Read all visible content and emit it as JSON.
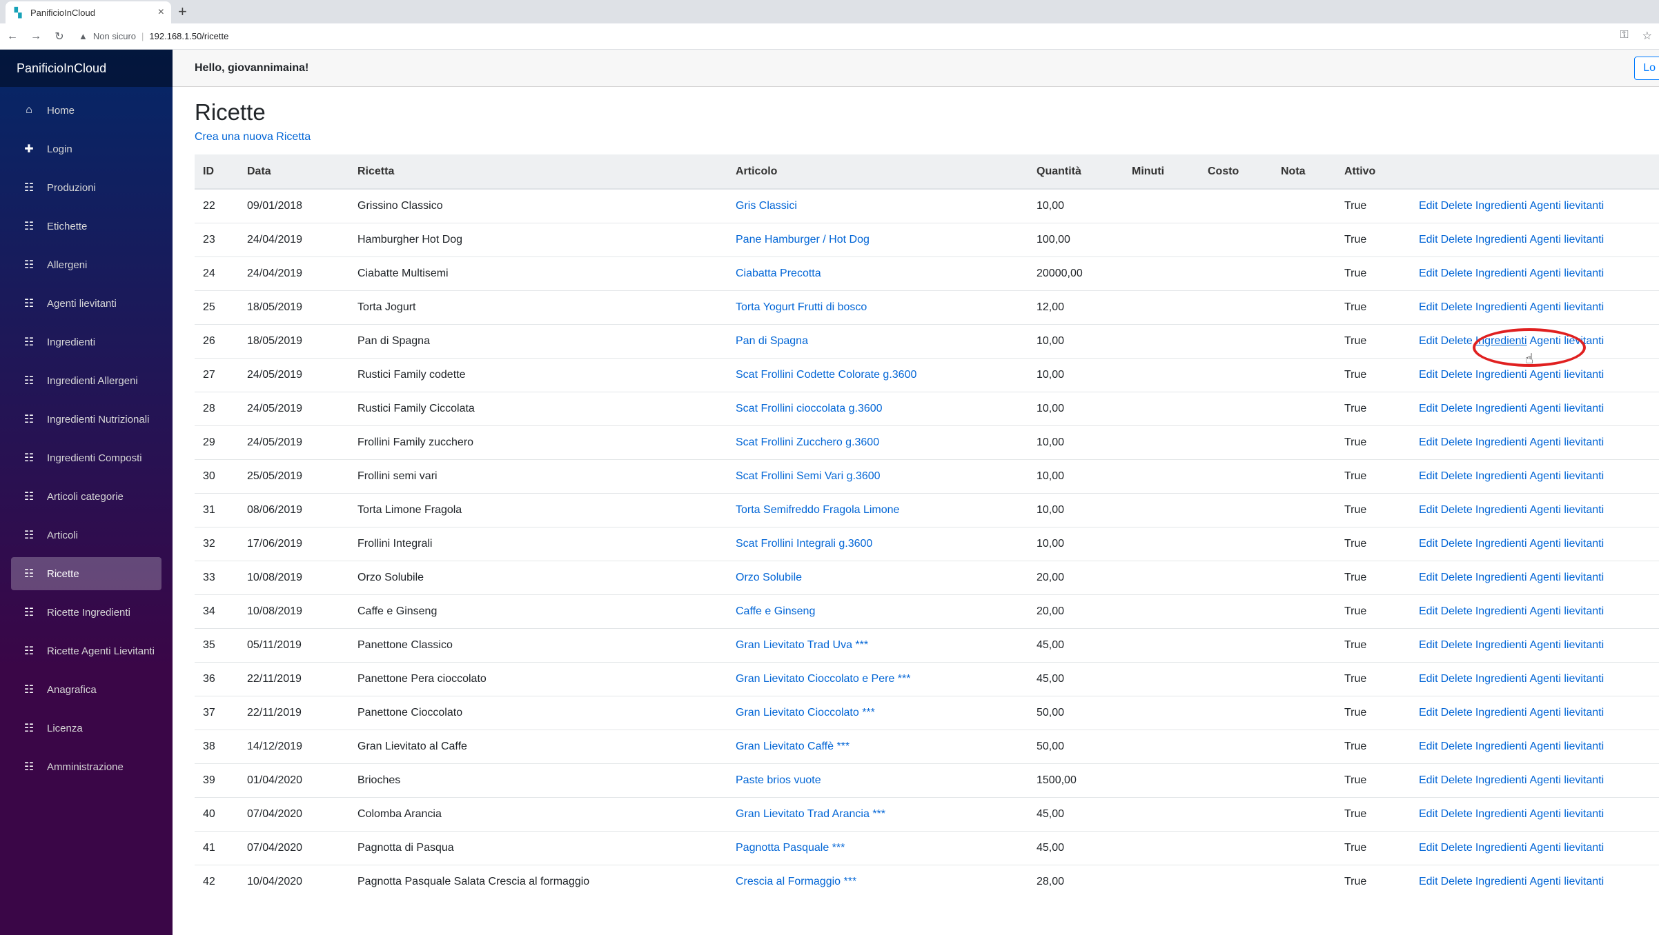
{
  "browser": {
    "tab_title": "PanificioInCloud",
    "new_tab": "+",
    "not_secure": "Non sicuro",
    "url": "192.168.1.50/ricette"
  },
  "sidebar": {
    "brand": "PanificioInCloud",
    "items": [
      {
        "label": "Home",
        "icon": "home-icon"
      },
      {
        "label": "Login",
        "icon": "plus-icon"
      },
      {
        "label": "Produzioni",
        "icon": "list-icon"
      },
      {
        "label": "Etichette",
        "icon": "list-icon"
      },
      {
        "label": "Allergeni",
        "icon": "list-icon"
      },
      {
        "label": "Agenti lievitanti",
        "icon": "list-icon"
      },
      {
        "label": "Ingredienti",
        "icon": "list-icon"
      },
      {
        "label": "Ingredienti Allergeni",
        "icon": "list-icon"
      },
      {
        "label": "Ingredienti Nutrizionali",
        "icon": "list-icon"
      },
      {
        "label": "Ingredienti Composti",
        "icon": "list-icon"
      },
      {
        "label": "Articoli categorie",
        "icon": "list-icon"
      },
      {
        "label": "Articoli",
        "icon": "list-icon"
      },
      {
        "label": "Ricette",
        "icon": "list-icon",
        "active": true
      },
      {
        "label": "Ricette Ingredienti",
        "icon": "list-icon"
      },
      {
        "label": "Ricette Agenti Lievitanti",
        "icon": "list-icon"
      },
      {
        "label": "Anagrafica",
        "icon": "list-icon"
      },
      {
        "label": "Licenza",
        "icon": "list-icon"
      },
      {
        "label": "Amministrazione",
        "icon": "list-icon"
      }
    ]
  },
  "header": {
    "greeting": "Hello, giovannimaina!",
    "logout": "Lo"
  },
  "main": {
    "title": "Ricette",
    "create_link": "Crea una nuova Ricetta",
    "columns": [
      "ID",
      "Data",
      "Ricetta",
      "Articolo",
      "Quantità",
      "Minuti",
      "Costo",
      "Nota",
      "Attivo"
    ],
    "actions": [
      "Edit",
      "Delete",
      "Ingredienti",
      "Agenti lievitanti"
    ],
    "rows": [
      {
        "id": "22",
        "data": "09/01/2018",
        "ricetta": "Grissino Classico",
        "articolo": "Gris Classici",
        "quantita": "10,00",
        "attivo": "True"
      },
      {
        "id": "23",
        "data": "24/04/2019",
        "ricetta": "Hamburgher Hot Dog",
        "articolo": "Pane Hamburger / Hot Dog",
        "quantita": "100,00",
        "attivo": "True"
      },
      {
        "id": "24",
        "data": "24/04/2019",
        "ricetta": "Ciabatte Multisemi",
        "articolo": "Ciabatta Precotta",
        "quantita": "20000,00",
        "attivo": "True"
      },
      {
        "id": "25",
        "data": "18/05/2019",
        "ricetta": "Torta Jogurt",
        "articolo": "Torta Yogurt Frutti di bosco",
        "quantita": "12,00",
        "attivo": "True"
      },
      {
        "id": "26",
        "data": "18/05/2019",
        "ricetta": "Pan di Spagna",
        "articolo": "Pan di Spagna",
        "quantita": "10,00",
        "attivo": "True"
      },
      {
        "id": "27",
        "data": "24/05/2019",
        "ricetta": "Rustici Family codette",
        "articolo": "Scat Frollini Codette Colorate g.3600",
        "quantita": "10,00",
        "attivo": "True"
      },
      {
        "id": "28",
        "data": "24/05/2019",
        "ricetta": "Rustici Family Ciccolata",
        "articolo": "Scat Frollini cioccolata g.3600",
        "quantita": "10,00",
        "attivo": "True"
      },
      {
        "id": "29",
        "data": "24/05/2019",
        "ricetta": "Frollini Family zucchero",
        "articolo": "Scat Frollini Zucchero g.3600",
        "quantita": "10,00",
        "attivo": "True"
      },
      {
        "id": "30",
        "data": "25/05/2019",
        "ricetta": "Frollini semi vari",
        "articolo": "Scat Frollini Semi Vari g.3600",
        "quantita": "10,00",
        "attivo": "True"
      },
      {
        "id": "31",
        "data": "08/06/2019",
        "ricetta": "Torta Limone Fragola",
        "articolo": "Torta Semifreddo Fragola Limone",
        "quantita": "10,00",
        "attivo": "True"
      },
      {
        "id": "32",
        "data": "17/06/2019",
        "ricetta": "Frollini Integrali",
        "articolo": "Scat Frollini Integrali g.3600",
        "quantita": "10,00",
        "attivo": "True"
      },
      {
        "id": "33",
        "data": "10/08/2019",
        "ricetta": "Orzo Solubile",
        "articolo": "Orzo Solubile",
        "quantita": "20,00",
        "attivo": "True"
      },
      {
        "id": "34",
        "data": "10/08/2019",
        "ricetta": "Caffe e Ginseng",
        "articolo": "Caffe e Ginseng",
        "quantita": "20,00",
        "attivo": "True"
      },
      {
        "id": "35",
        "data": "05/11/2019",
        "ricetta": "Panettone Classico",
        "articolo": "Gran Lievitato Trad Uva ***",
        "quantita": "45,00",
        "attivo": "True"
      },
      {
        "id": "36",
        "data": "22/11/2019",
        "ricetta": "Panettone Pera cioccolato",
        "articolo": "Gran Lievitato Cioccolato e Pere ***",
        "quantita": "45,00",
        "attivo": "True"
      },
      {
        "id": "37",
        "data": "22/11/2019",
        "ricetta": "Panettone Cioccolato",
        "articolo": "Gran Lievitato Cioccolato ***",
        "quantita": "50,00",
        "attivo": "True"
      },
      {
        "id": "38",
        "data": "14/12/2019",
        "ricetta": "Gran Lievitato al Caffe",
        "articolo": "Gran Lievitato Caffè ***",
        "quantita": "50,00",
        "attivo": "True"
      },
      {
        "id": "39",
        "data": "01/04/2020",
        "ricetta": "Brioches",
        "articolo": "Paste brios vuote",
        "quantita": "1500,00",
        "attivo": "True"
      },
      {
        "id": "40",
        "data": "07/04/2020",
        "ricetta": "Colomba Arancia",
        "articolo": "Gran Lievitato Trad Arancia ***",
        "quantita": "45,00",
        "attivo": "True"
      },
      {
        "id": "41",
        "data": "07/04/2020",
        "ricetta": "Pagnotta di Pasqua",
        "articolo": "Pagnotta Pasquale ***",
        "quantita": "45,00",
        "attivo": "True"
      },
      {
        "id": "42",
        "data": "10/04/2020",
        "ricetta": "Pagnotta Pasquale Salata Crescia al formaggio",
        "articolo": "Crescia al Formaggio ***",
        "quantita": "28,00",
        "attivo": "True"
      }
    ]
  },
  "colors": {
    "link": "#0366d6",
    "highlight_circle": "#e02020"
  }
}
